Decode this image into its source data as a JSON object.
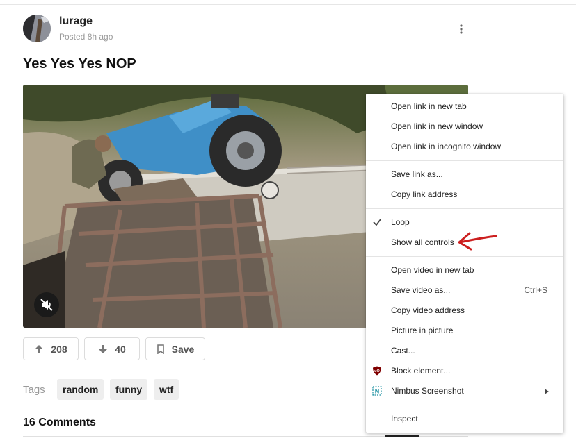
{
  "post": {
    "username": "lurage",
    "posted": "Posted 8h ago",
    "title": "Yes Yes Yes NOP"
  },
  "actions": {
    "upvotes": "208",
    "downvotes": "40",
    "save_label": "Save"
  },
  "tags": {
    "label": "Tags",
    "items": [
      "random",
      "funny",
      "wtf"
    ]
  },
  "comments": {
    "title": "16 Comments"
  },
  "context_menu": {
    "items": [
      {
        "label": "Open link in new tab"
      },
      {
        "label": "Open link in new window"
      },
      {
        "label": "Open link in incognito window"
      },
      {
        "label": "Save link as..."
      },
      {
        "label": "Copy link address"
      },
      {
        "label": "Loop",
        "checked": true
      },
      {
        "label": "Show all controls"
      },
      {
        "label": "Open video in new tab"
      },
      {
        "label": "Save video as...",
        "shortcut": "Ctrl+S"
      },
      {
        "label": "Copy video address"
      },
      {
        "label": "Picture in picture"
      },
      {
        "label": "Cast..."
      },
      {
        "label": "Block element...",
        "icon": "ublock-shield-icon"
      },
      {
        "label": "Nimbus Screenshot",
        "icon": "nimbus-icon",
        "submenu": true
      },
      {
        "label": "Inspect"
      }
    ]
  },
  "colors": {
    "annotation_arrow": "#cc1f1f",
    "tag_bg": "#eeeeee",
    "ublock": "#800000",
    "nimbus": "#1a8fa0"
  }
}
